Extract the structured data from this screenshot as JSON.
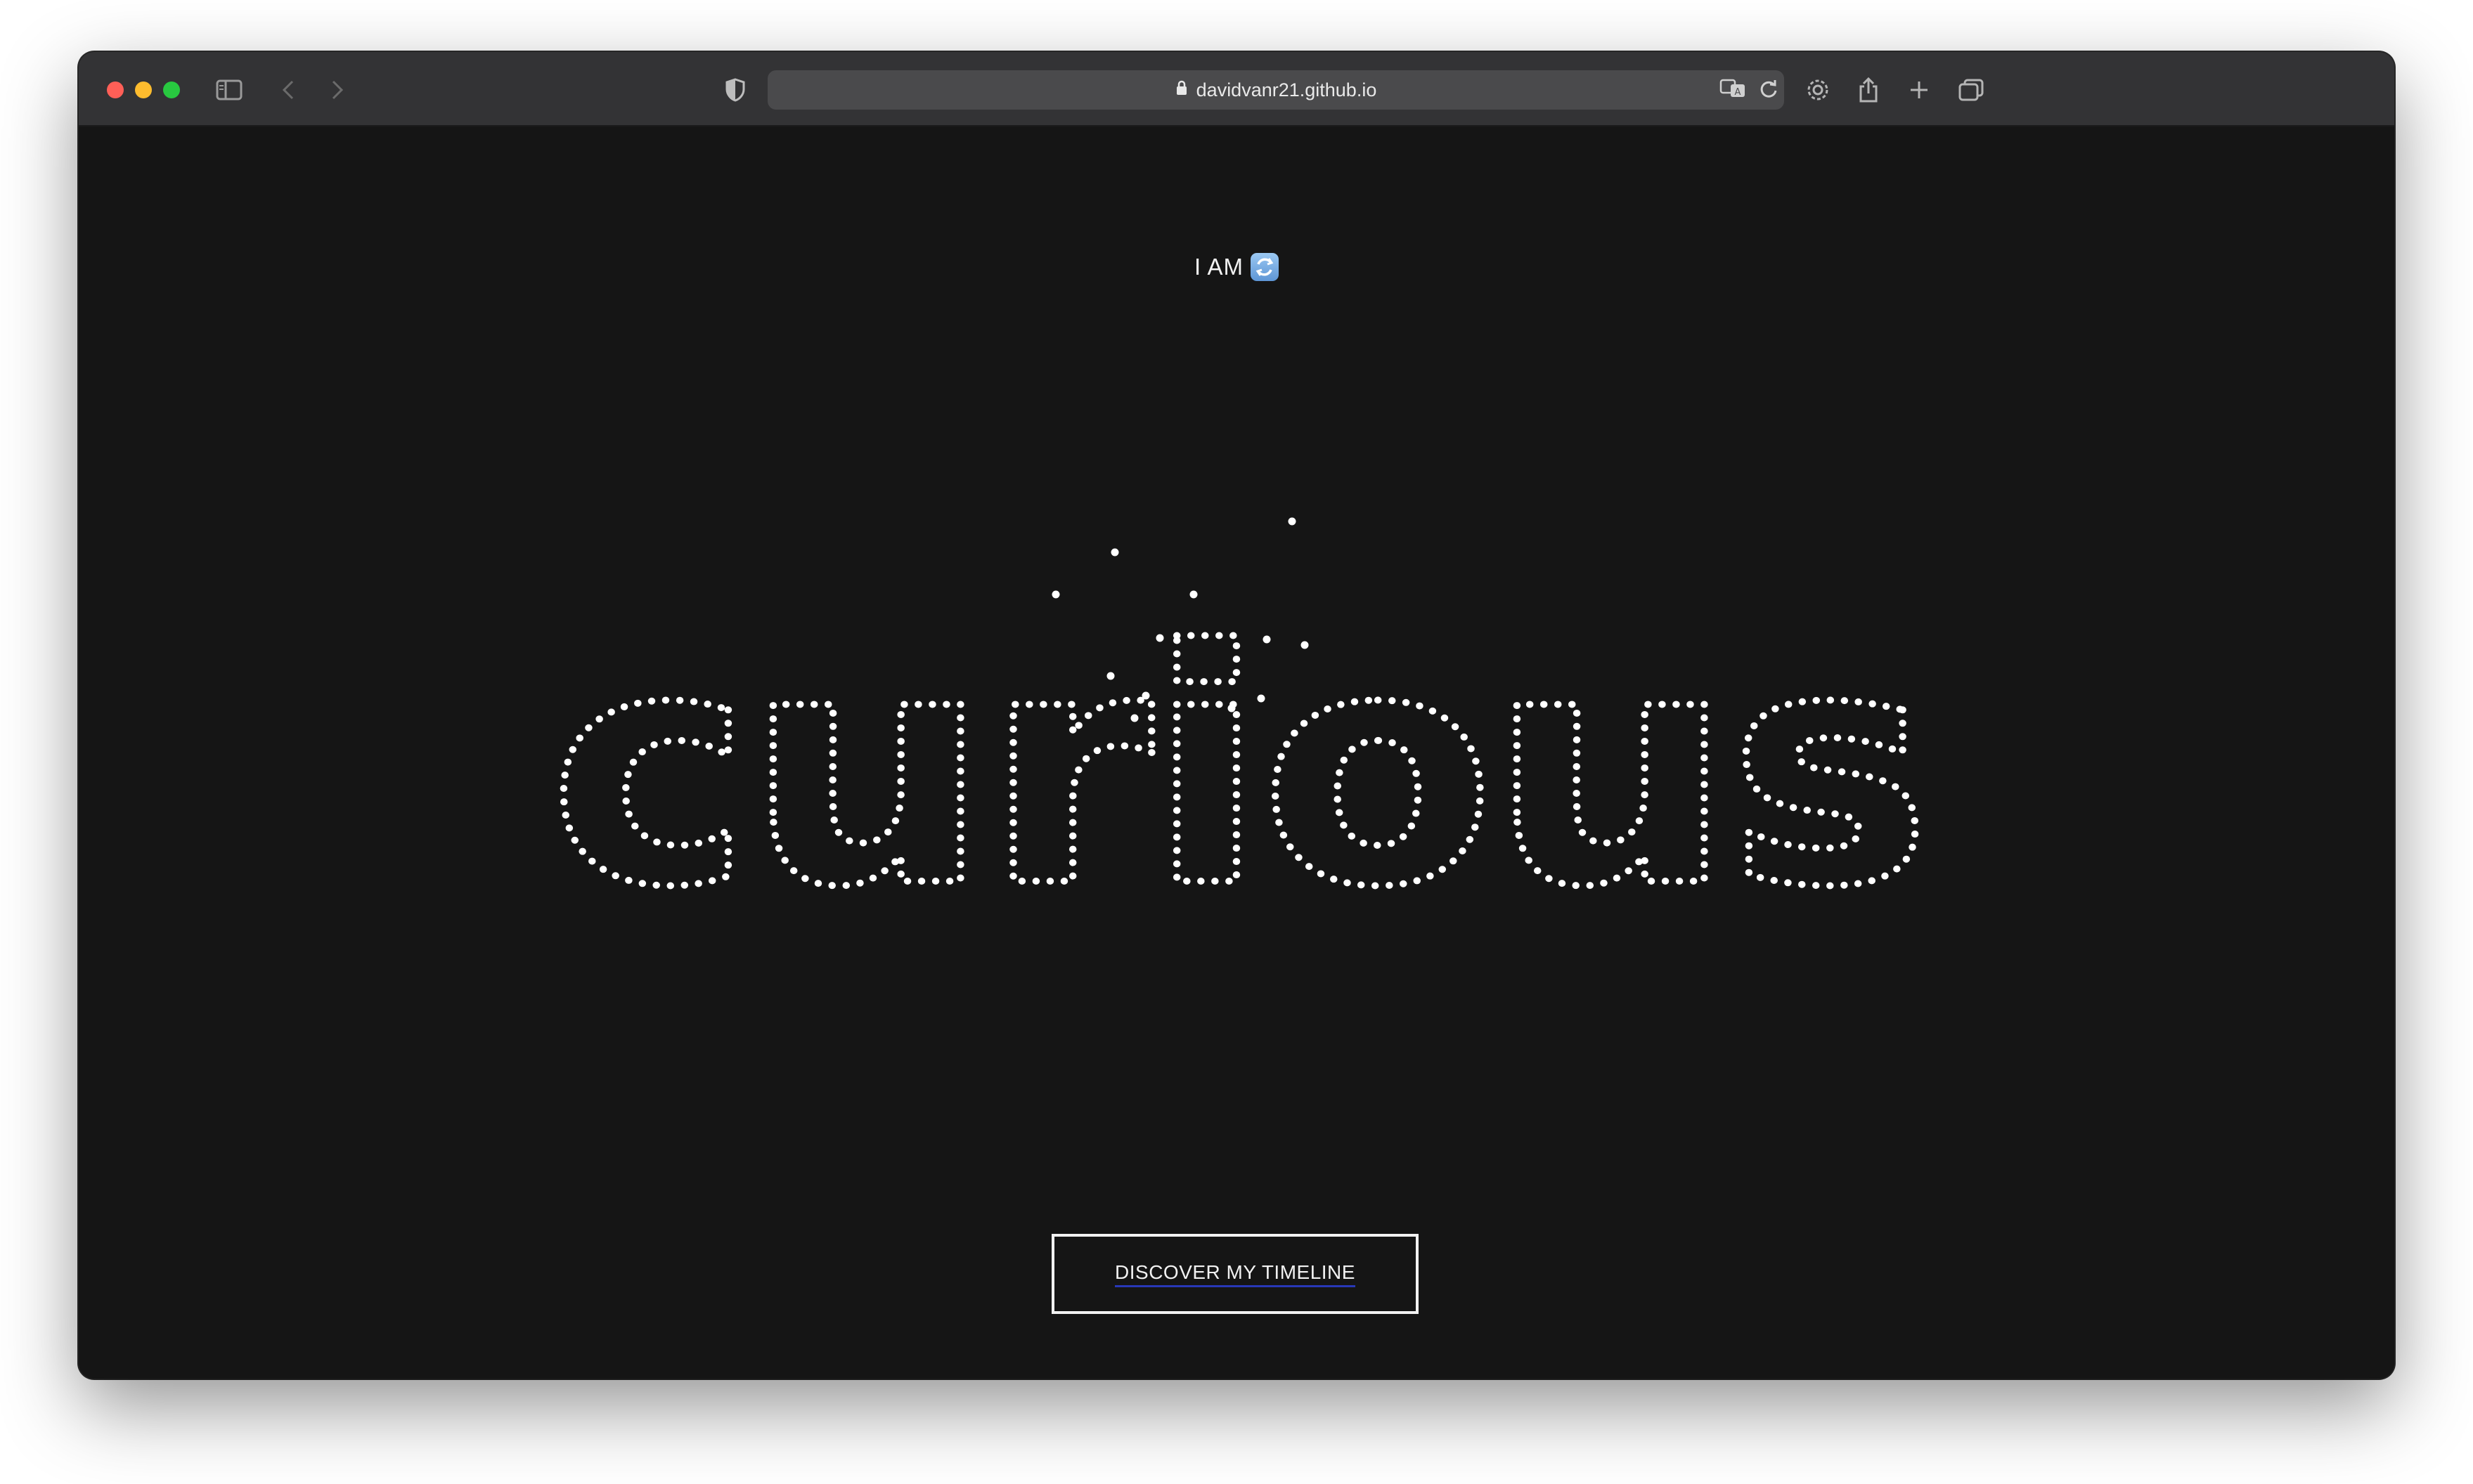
{
  "browser": {
    "url": "davidvanr21.github.io"
  },
  "hero": {
    "prefix": "I AM",
    "word": "curious"
  },
  "cta": {
    "label": "DISCOVER MY TIMELINE"
  },
  "colors": {
    "background": "#151515",
    "toolbar": "#333335",
    "text": "#f2f2f2",
    "close": "#ff5f57",
    "minimize": "#febc2e",
    "maximize": "#28c840"
  }
}
